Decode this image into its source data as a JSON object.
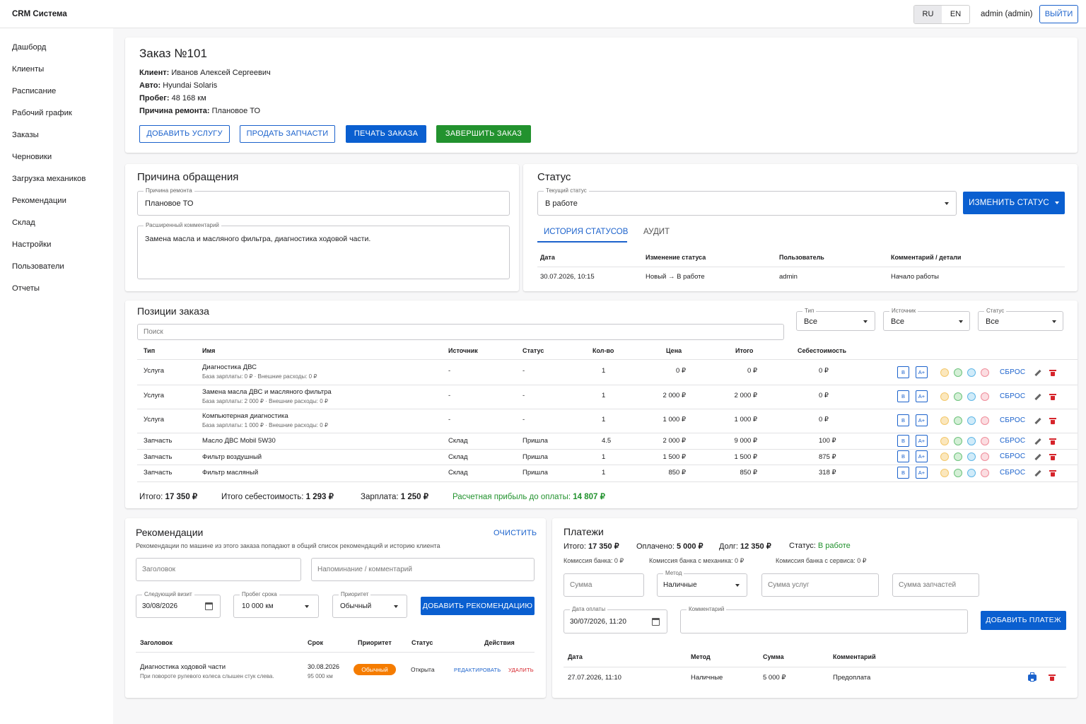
{
  "app": {
    "title": "CRM Система",
    "lang_ru": "RU",
    "lang_en": "EN",
    "user": "admin (admin)",
    "logout": "ВЫЙТИ"
  },
  "nav": [
    "Дашборд",
    "Клиенты",
    "Расписание",
    "Рабочий график",
    "Заказы",
    "Черновики",
    "Загрузка механиков",
    "Рекомендации",
    "Склад",
    "Настройки",
    "Пользователи",
    "Отчеты"
  ],
  "order": {
    "title": "Заказ №101",
    "client_label": "Клиент:",
    "client": "Иванов Алексей Сергеевич",
    "car_label": "Авто:",
    "car": "Hyundai Solaris",
    "mileage_label": "Пробег:",
    "mileage": "48 168 км",
    "reason_label": "Причина ремонта:",
    "reason": "Плановое ТО",
    "btn_add_service": "ДОБАВИТЬ УСЛУГУ",
    "btn_sell_parts": "ПРОДАТЬ ЗАПЧАСТИ",
    "btn_print": "ПЕЧАТЬ ЗАКАЗА",
    "btn_finish": "ЗАВЕРШИТЬ ЗАКАЗ"
  },
  "appeal": {
    "title": "Причина обращения",
    "reason_label": "Причина ремонта",
    "reason_value": "Плановое ТО",
    "comment_label": "Расширенный комментарий",
    "comment_value": "Замена масла и масляного фильтра, диагностика ходовой части."
  },
  "status": {
    "title": "Статус",
    "current_label": "Текущий статус",
    "current_value": "В работе",
    "change_btn": "ИЗМЕНИТЬ СТАТУС",
    "tab_history": "ИСТОРИЯ СТАТУСОВ",
    "tab_audit": "АУДИТ",
    "headers": [
      "Дата",
      "Изменение статуса",
      "Пользователь",
      "Комментарий / детали"
    ],
    "rows": [
      [
        "30.07.2026, 10:15",
        "Новый → В работе",
        "admin",
        "Начало работы"
      ]
    ]
  },
  "positions": {
    "title": "Позиции заказа",
    "search_placeholder": "Поиск",
    "filter_type_label": "Тип",
    "filter_type": "Все",
    "filter_source_label": "Источник",
    "filter_source": "Все",
    "filter_status_label": "Статус",
    "filter_status": "Все",
    "headers": [
      "Тип",
      "Имя",
      "Источник",
      "Статус",
      "Кол-во",
      "Цена",
      "Итого",
      "Себестоимость"
    ],
    "reset": "СБРОС",
    "b_label": "B",
    "aplus_label": "A+",
    "rows": [
      {
        "type": "Услуга",
        "name": "Диагностика ДВС",
        "sub": "База зарплаты: 0 ₽ · Внешние расходы: 0 ₽",
        "source": "-",
        "status": "-",
        "qty": "1",
        "price": "0 ₽",
        "total": "0 ₽",
        "cost": "0 ₽"
      },
      {
        "type": "Услуга",
        "name": "Замена масла ДВС и масляного фильтра",
        "sub": "База зарплаты: 2 000 ₽ · Внешние расходы: 0 ₽",
        "source": "-",
        "status": "-",
        "qty": "1",
        "price": "2 000 ₽",
        "total": "2 000 ₽",
        "cost": "0 ₽"
      },
      {
        "type": "Услуга",
        "name": "Компьютерная диагностика",
        "sub": "База зарплаты: 1 000 ₽ · Внешние расходы: 0 ₽",
        "source": "-",
        "status": "-",
        "qty": "1",
        "price": "1 000 ₽",
        "total": "1 000 ₽",
        "cost": "0 ₽"
      },
      {
        "type": "Запчасть",
        "name": "Масло ДВС Mobil 5W30",
        "sub": "",
        "source": "Склад",
        "status": "Пришла",
        "qty": "4.5",
        "price": "2 000 ₽",
        "total": "9 000 ₽",
        "cost": "100 ₽"
      },
      {
        "type": "Запчасть",
        "name": "Фильтр воздушный",
        "sub": "",
        "source": "Склад",
        "status": "Пришла",
        "qty": "1",
        "price": "1 500 ₽",
        "total": "1 500 ₽",
        "cost": "875 ₽"
      },
      {
        "type": "Запчасть",
        "name": "Фильтр масляный",
        "sub": "",
        "source": "Склад",
        "status": "Пришла",
        "qty": "1",
        "price": "850 ₽",
        "total": "850 ₽",
        "cost": "318 ₽"
      }
    ],
    "totals": {
      "total_label": "Итого:",
      "total": "17 350 ₽",
      "cost_label": "Итого себестоимость:",
      "cost": "1 293 ₽",
      "salary_label": "Зарплата:",
      "salary": "1 250 ₽",
      "profit_label": "Расчетная прибыль до оплаты:",
      "profit": "14 807 ₽"
    }
  },
  "recs": {
    "title": "Рекомендации",
    "clear": "ОЧИСТИТЬ",
    "hint": "Рекомендации по машине из этого заказа попадают в общий список рекомендаций и историю клиента",
    "title_placeholder": "Заголовок",
    "note_placeholder": "Напоминание / комментарий",
    "visit_label": "Следующий визит",
    "visit": "30/08/2026",
    "mileage_label": "Пробег срока",
    "mileage": "10 000 км",
    "priority_label": "Приоритет",
    "priority": "Обычный",
    "add_btn": "ДОБАВИТЬ РЕКОМЕНДАЦИЮ",
    "headers": [
      "Заголовок",
      "Срок",
      "Приоритет",
      "Статус",
      "Действия"
    ],
    "rows": [
      {
        "title": "Диагностика ходовой части",
        "desc": "При повороте рулевого колеса слышен стук слева.",
        "date": "30.08.2026",
        "km": "95 000 км",
        "priority": "Обычный",
        "status": "Открыта",
        "edit": "РЕДАКТИРОВАТЬ",
        "delete": "УДАЛИТЬ"
      }
    ]
  },
  "payments": {
    "title": "Платежи",
    "total_label": "Итого:",
    "total": "17 350 ₽",
    "paid_label": "Оплачено:",
    "paid": "5 000 ₽",
    "debt_label": "Долг:",
    "debt": "12 350 ₽",
    "status_label": "Статус:",
    "status": "В работе",
    "fee_bank": "Комиссия банка: 0 ₽",
    "fee_mech": "Комиссия банка с механика: 0 ₽",
    "fee_service": "Комиссия банка с сервиса: 0 ₽",
    "sum_placeholder": "Сумма",
    "method_label": "Метод",
    "method": "Наличные",
    "services_placeholder": "Сумма услуг",
    "parts_placeholder": "Сумма запчастей",
    "date_label": "Дата оплаты",
    "date": "30/07/2026, 11:20",
    "comment_label": "Комментарий",
    "add_btn": "ДОБАВИТЬ ПЛАТЕЖ",
    "headers": [
      "Дата",
      "Метод",
      "Сумма",
      "Комментарий"
    ],
    "rows": [
      {
        "date": "27.07.2026, 11:10",
        "method": "Наличные",
        "sum": "5 000 ₽",
        "comment": "Предоплата"
      }
    ]
  },
  "colors": {
    "accent": "#0a5fd0",
    "success": "#22922e",
    "danger": "#d6242b",
    "warning": "#f57c00"
  }
}
